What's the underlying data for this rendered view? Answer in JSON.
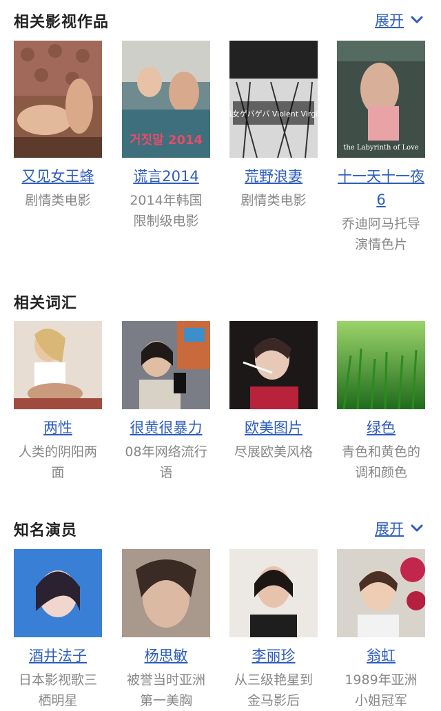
{
  "sections": [
    {
      "title": "相关影视作品",
      "expand_label": "展开",
      "items": [
        {
          "name": "又见女王蜂",
          "desc": "剧情类电影"
        },
        {
          "name": "谎言2014",
          "desc": "2014年韩国限制级电影"
        },
        {
          "name": "荒野浪妻",
          "desc": "剧情类电影"
        },
        {
          "name": "十一天十一夜6",
          "desc": "乔迪阿马托导演情色片"
        }
      ],
      "thumbs": [
        {
          "poster_text": ""
        },
        {
          "poster_text": "거짓말 2014"
        },
        {
          "poster_text": "処女ゲバゲバ Violent Virgin"
        },
        {
          "poster_text": "the Labyrinth of Love"
        }
      ]
    },
    {
      "title": "相关词汇",
      "items": [
        {
          "name": "两性",
          "desc": "人类的阴阳两面"
        },
        {
          "name": "很黄很暴力",
          "desc": "08年网络流行语"
        },
        {
          "name": "欧美图片",
          "desc": "尽展欧美风格"
        },
        {
          "name": "绿色",
          "desc": "青色和黄色的调和颜色"
        }
      ]
    },
    {
      "title": "知名演员",
      "expand_label": "展开",
      "items": [
        {
          "name": "酒井法子",
          "desc": "日本影视歌三栖明星"
        },
        {
          "name": "杨思敏",
          "desc": "被誉当时亚洲第一美胸"
        },
        {
          "name": "李丽珍",
          "desc": "从三级艳星到金马影后"
        },
        {
          "name": "翁虹",
          "desc": "1989年亚洲小姐冠军"
        }
      ]
    }
  ],
  "colors": {
    "link": "#2b5cbf",
    "muted": "#888888",
    "title": "#222222"
  }
}
